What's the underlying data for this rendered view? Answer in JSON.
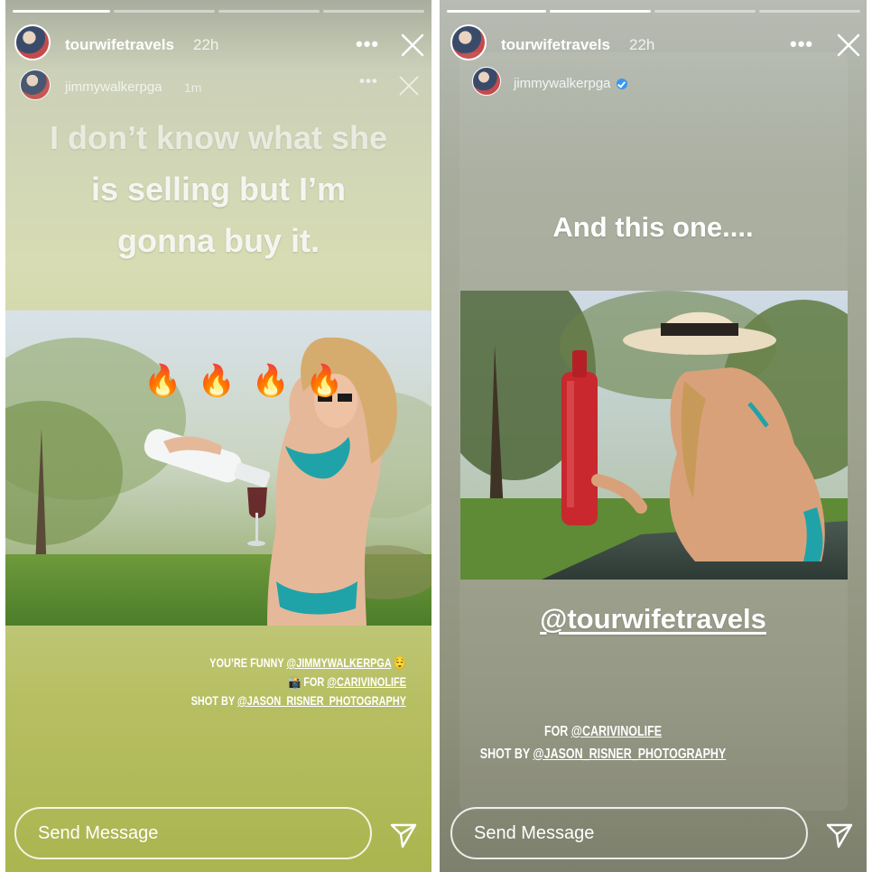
{
  "left_story": {
    "username": "tourwifetravels",
    "time": "22h",
    "more_label": "•••",
    "repost": {
      "username": "jimmywalkerpga",
      "time": "1m",
      "more_label": "•••"
    },
    "caption_lines": [
      "I don’t know what she",
      "is selling but I’m",
      "gonna buy it."
    ],
    "flames": "🔥 🔥 🔥 🔥",
    "small_caption": {
      "line1_text": "YOU’RE FUNNY ",
      "line1_mention": "@JIMMYWALKERPGA",
      "line1_emoji": "😌",
      "line2_emoji": "📸",
      "line2_text": " FOR ",
      "line2_mention": "@CARIVINOLIFE",
      "line3_text": "SHOT BY ",
      "line3_mention": "@JASON_RISNER_PHOTOGRAPHY"
    },
    "message_placeholder": "Send Message"
  },
  "right_story": {
    "username": "tourwifetravels",
    "time": "22h",
    "more_label": "•••",
    "repost": {
      "username": "jimmywalkerpga"
    },
    "caption": "And this one....",
    "mention": "@tourwifetravels",
    "small_caption": {
      "line1_text": "FOR ",
      "line1_mention": "@CARIVINOLIFE",
      "line2_text": "SHOT BY ",
      "line2_mention": "@JASON_RISNER_PHOTOGRAPHY"
    },
    "message_placeholder": "Send Message"
  },
  "colors": {
    "verified": "#3897f0",
    "wine_bottle_red": "#c8282e",
    "bikini_teal": "#1fa3a8"
  }
}
